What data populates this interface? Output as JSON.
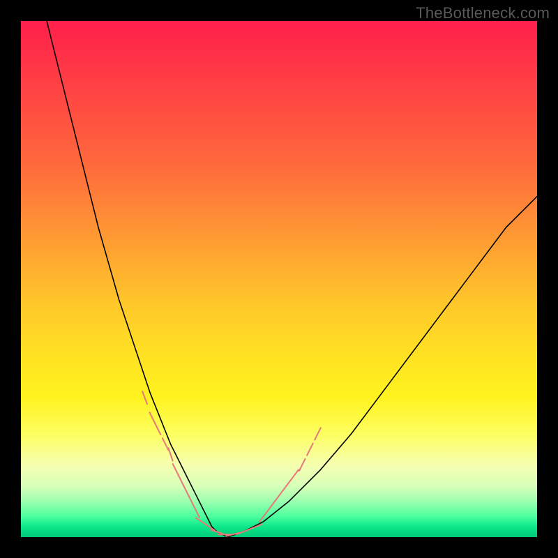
{
  "watermark": "TheBottleneck.com",
  "chart_data": {
    "type": "line",
    "title": "",
    "xlabel": "",
    "ylabel": "",
    "xlim": [
      0,
      100
    ],
    "ylim": [
      0,
      100
    ],
    "grid": false,
    "legend": false,
    "series": [
      {
        "name": "bottleneck-curve",
        "color": "#000000",
        "x": [
          5,
          7,
          9,
          11,
          13,
          15,
          17,
          19,
          21,
          23,
          25,
          27,
          29,
          31,
          33,
          34,
          35,
          36,
          37,
          38,
          40,
          43,
          47,
          52,
          58,
          64,
          70,
          76,
          82,
          88,
          94,
          100
        ],
        "y": [
          100,
          92,
          84,
          76,
          68,
          60,
          53,
          46,
          40,
          34,
          28,
          23,
          18,
          14,
          10,
          8,
          6,
          4,
          2,
          1,
          0,
          1,
          3,
          7,
          13,
          20,
          28,
          36,
          44,
          52,
          60,
          66
        ]
      },
      {
        "name": "highlight-dots-left",
        "type": "scatter",
        "color": "#e77a7a",
        "x": [
          24,
          25.5,
          26.5,
          28,
          29,
          30,
          31,
          32,
          33,
          34
        ],
        "y": [
          27,
          23,
          21,
          18,
          16,
          13,
          11,
          9,
          7,
          5
        ]
      },
      {
        "name": "highlight-dots-bottom",
        "type": "scatter",
        "color": "#e77a7a",
        "x": [
          35,
          36.5,
          38,
          39.5,
          41,
          43,
          45.5
        ],
        "y": [
          3,
          2,
          1,
          0.5,
          0.5,
          1,
          2
        ]
      },
      {
        "name": "highlight-dots-right",
        "type": "scatter",
        "color": "#e77a7a",
        "x": [
          47,
          48.5,
          50,
          51.5,
          53,
          54.5,
          56,
          57.5
        ],
        "y": [
          4,
          6,
          8,
          10,
          12,
          14,
          17,
          20
        ]
      }
    ],
    "annotations": []
  }
}
